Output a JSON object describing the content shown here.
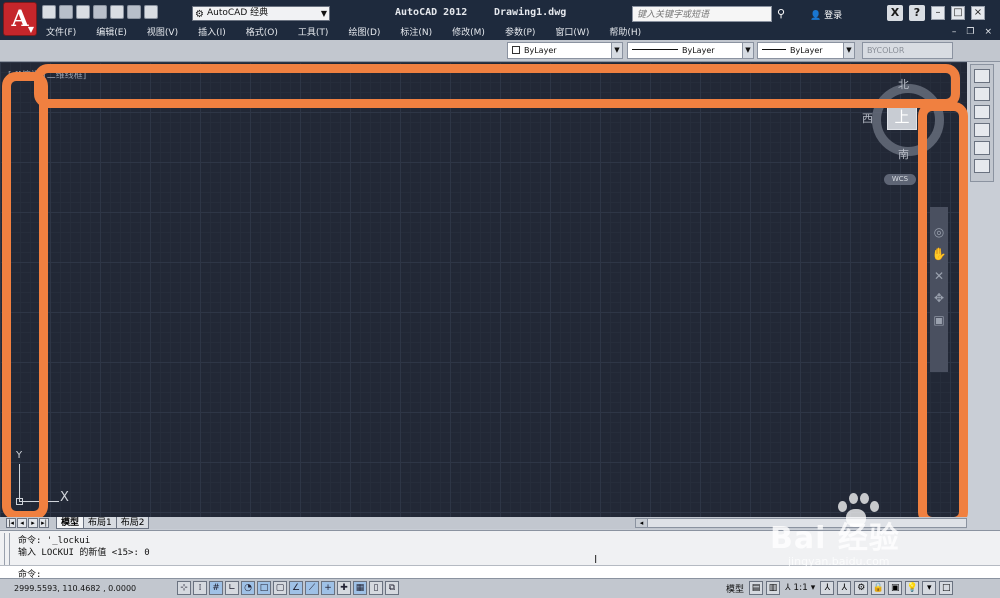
{
  "titlebar": {
    "app_button_letter": "A",
    "workspace": "AutoCAD 经典",
    "app_title": "AutoCAD 2012",
    "file_title": "Drawing1.dwg",
    "search_placeholder": "键入关键字或短语",
    "login_label": "登录",
    "help_label": "?"
  },
  "menus": [
    "文件(F)",
    "编辑(E)",
    "视图(V)",
    "插入(I)",
    "格式(O)",
    "工具(T)",
    "绘图(D)",
    "标注(N)",
    "修改(M)",
    "参数(P)",
    "窗口(W)",
    "帮助(H)"
  ],
  "properties": {
    "color": "ByLayer",
    "linetype": "ByLayer",
    "lineweight": "ByLayer",
    "plotstyle": "BYCOLOR"
  },
  "viewport": {
    "label": "[-][俯视][二维线框]",
    "viewcube": {
      "north": "北",
      "south": "南",
      "west": "西",
      "top": "上",
      "wcs": "WCS"
    },
    "ucs": {
      "x": "X",
      "y": "Y"
    }
  },
  "layout_tabs": [
    "模型",
    "布局1",
    "布局2"
  ],
  "command": {
    "line1": "命令: '_lockui",
    "line2": "输入 LOCKUI 的新值 <15>: 0",
    "prompt": "命令:"
  },
  "status": {
    "coords": "2999.5593, 110.4682 , 0.0000",
    "model_label": "模型",
    "annotation_scale": "1:1"
  },
  "watermark": {
    "brand": "Bai  经验",
    "url": "jingyan.baidu.com"
  },
  "colors": {
    "canvas": "#222836",
    "titlebar": "#1e2a3d",
    "highlight": "#f08040"
  }
}
